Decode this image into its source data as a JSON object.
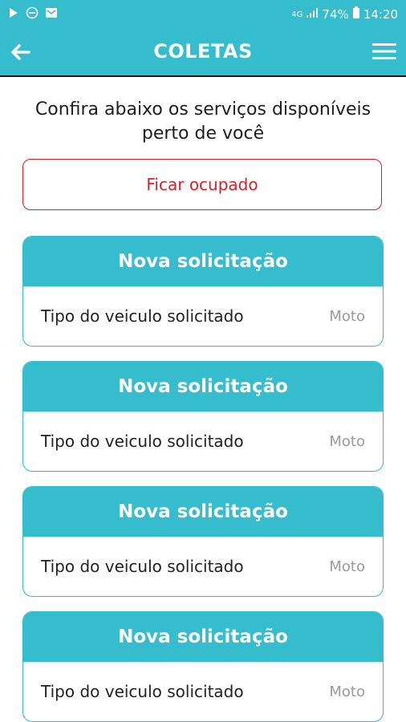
{
  "status_bar": {
    "battery": "74%",
    "network": "4G",
    "time": "14:20"
  },
  "app_bar": {
    "title": "COLETAS"
  },
  "intro_text_line1": "Confira abaixo os serviços disponíveis",
  "intro_text_line2": "perto de você",
  "busy_button_label": "Ficar ocupado",
  "requests": [
    {
      "title": "Nova solicitação",
      "label": "Tipo do veiculo solicitado",
      "value": "Moto"
    },
    {
      "title": "Nova solicitação",
      "label": "Tipo do veiculo solicitado",
      "value": "Moto"
    },
    {
      "title": "Nova solicitação",
      "label": "Tipo do veiculo solicitado",
      "value": "Moto"
    },
    {
      "title": "Nova solicitação",
      "label": "Tipo do veiculo solicitado",
      "value": "Moto"
    }
  ],
  "colors": {
    "primary": "#35bccd",
    "danger": "#d9202a",
    "muted": "#9a9a9a"
  }
}
